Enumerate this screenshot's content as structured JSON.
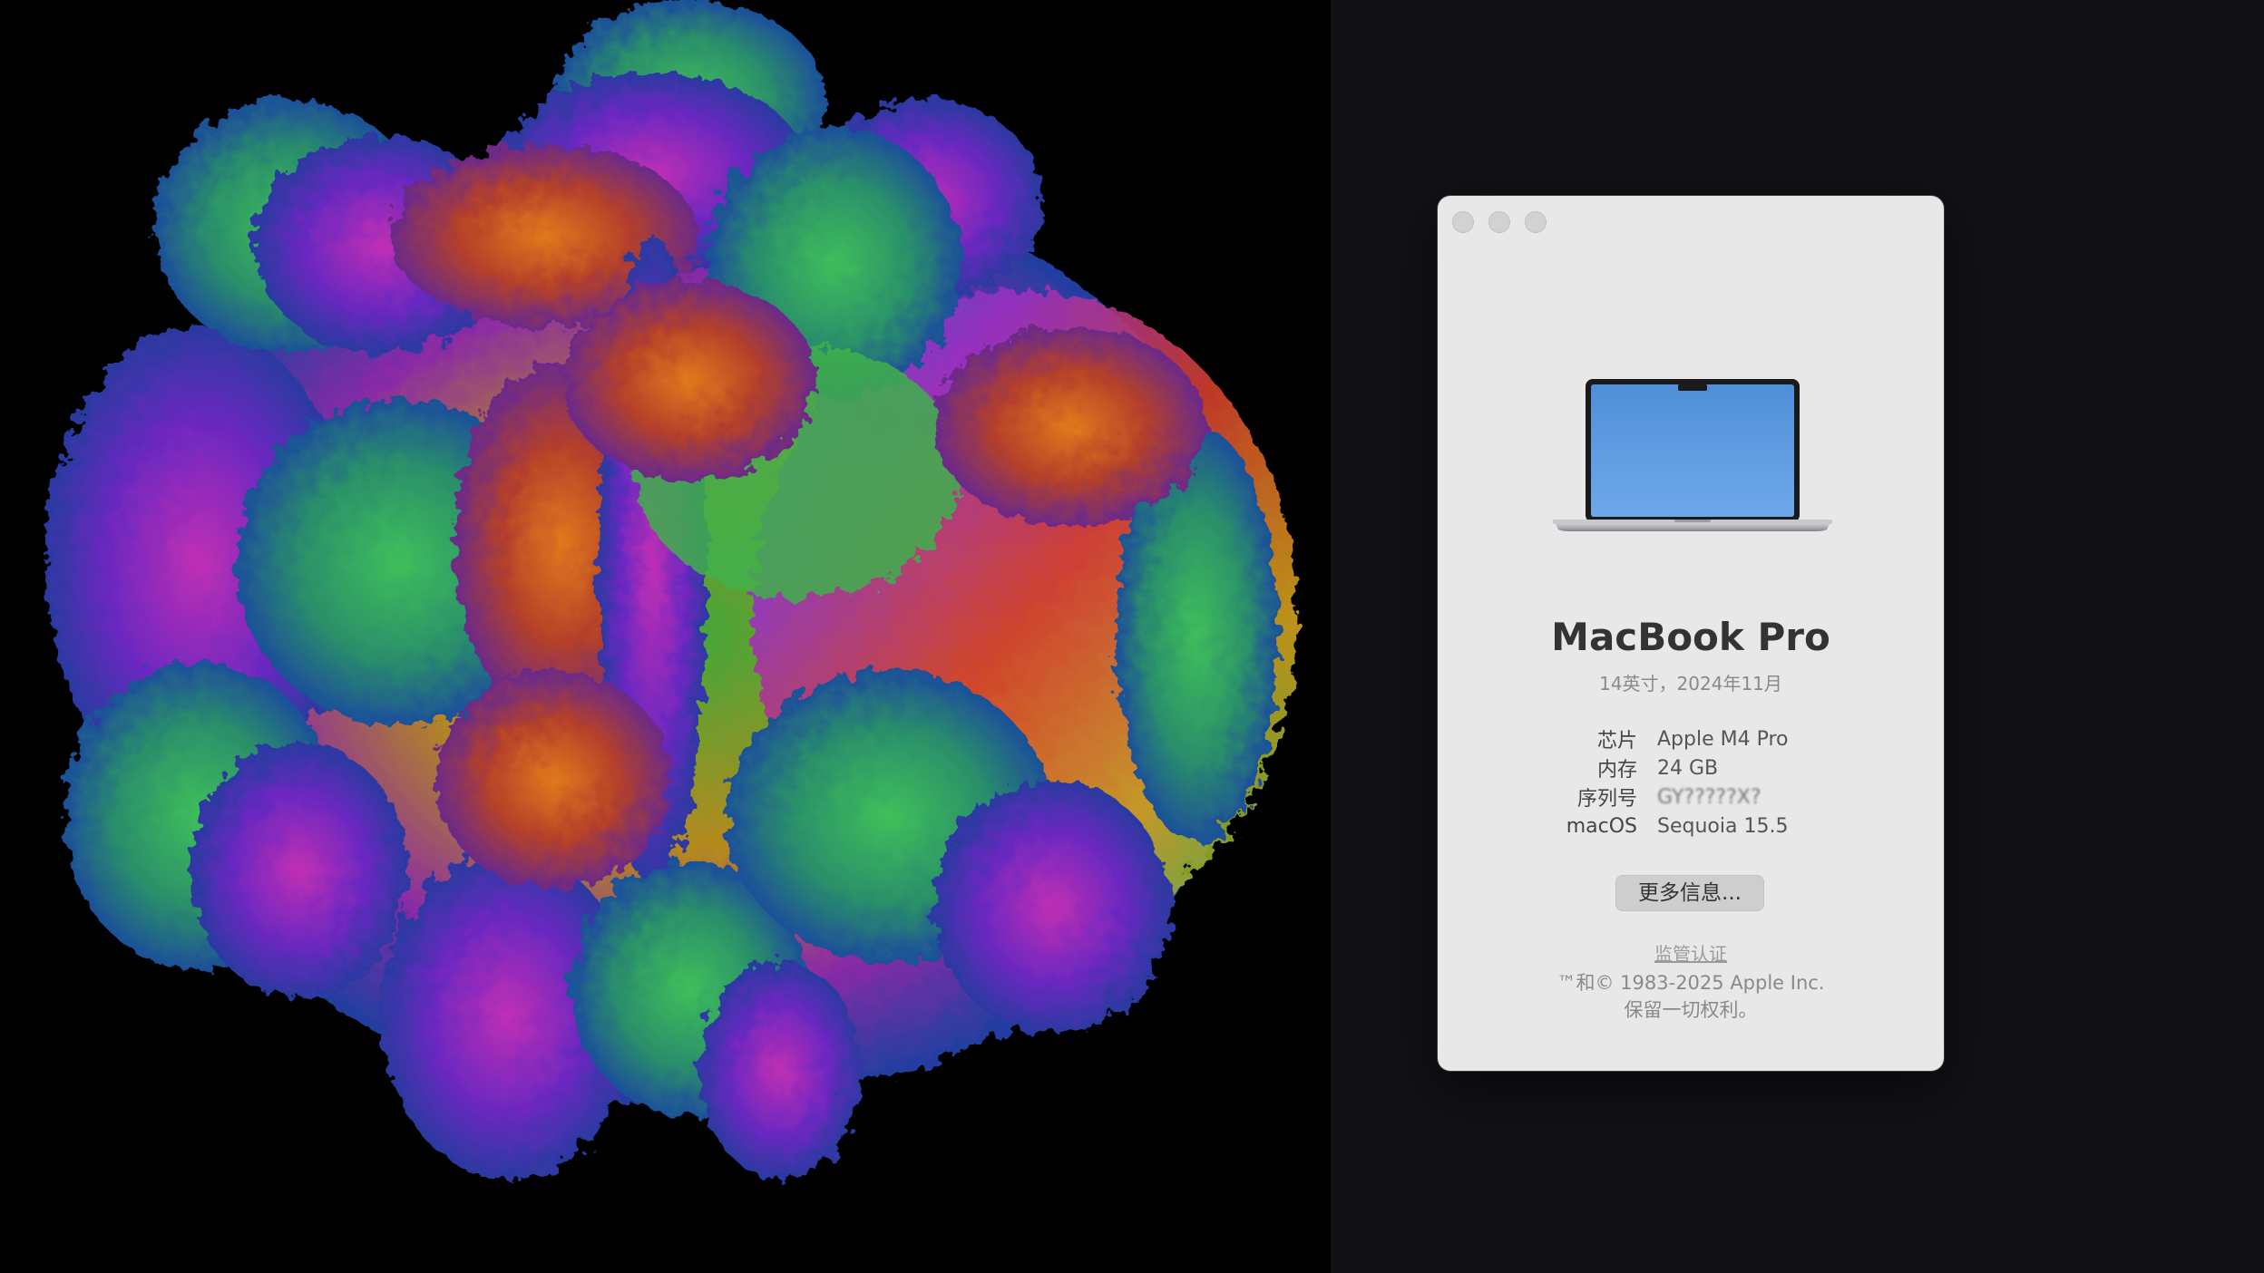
{
  "about": {
    "model_name": "MacBook Pro",
    "model_subtitle": "14英寸，2024年11月",
    "specs": [
      {
        "key": "芯片",
        "value": "Apple M4 Pro"
      },
      {
        "key": "内存",
        "value": "24 GB"
      },
      {
        "key": "序列号",
        "value": "GY?????X?"
      },
      {
        "key": "macOS",
        "value": "Sequoia 15.5"
      }
    ],
    "more_info_label": "更多信息...",
    "regulatory_label": "监管认证",
    "copyright_line1": "™和© 1983-2025 Apple Inc.",
    "copyright_line2": "保留一切权利。"
  },
  "colors": {
    "window_bg": "#e9e8e9",
    "desktop_bg": "#121216",
    "screen_blue": "#5b9be0"
  },
  "icons": {
    "laptop": "macbook-pro-illustration",
    "fractal": "3d-fractal-render"
  }
}
